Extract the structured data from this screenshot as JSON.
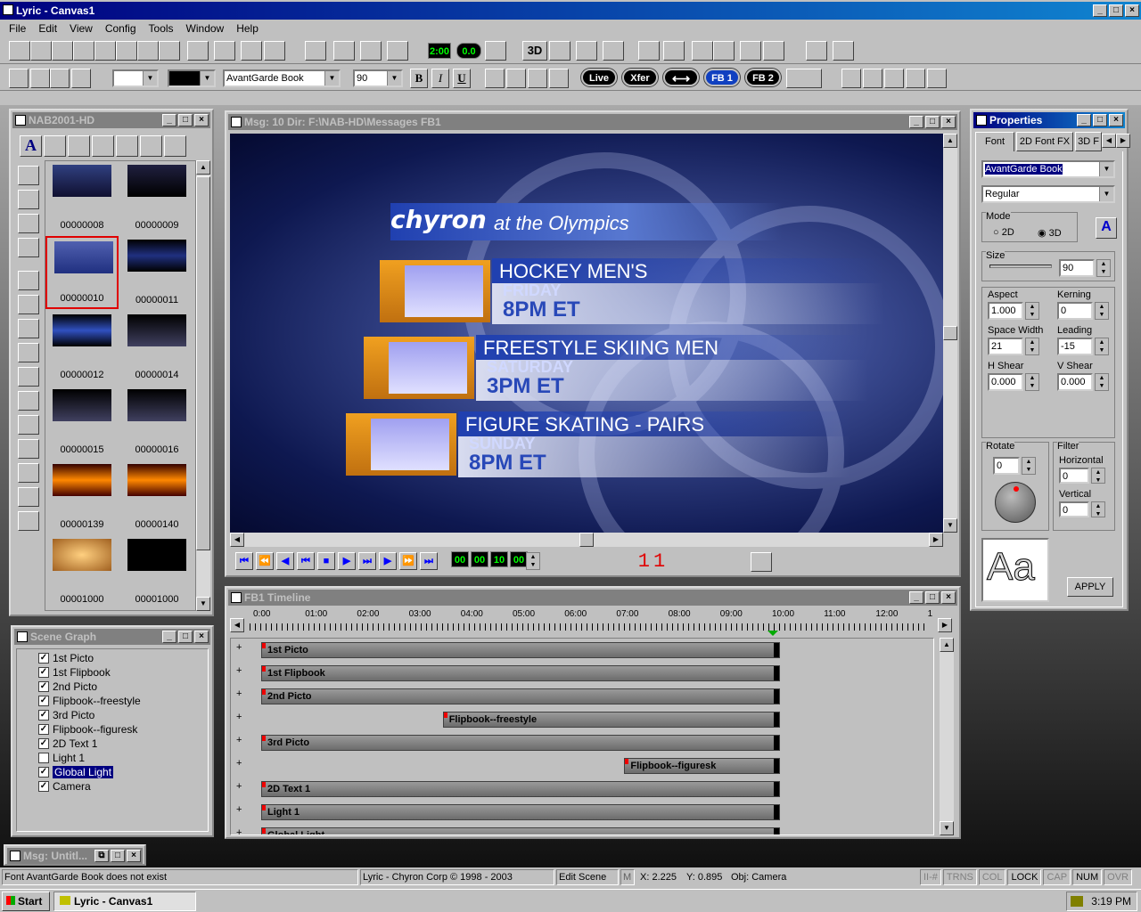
{
  "app": {
    "title": "Lyric - Canvas1"
  },
  "menu": [
    "File",
    "Edit",
    "View",
    "Config",
    "Tools",
    "Window",
    "Help"
  ],
  "toolbar2": {
    "font_name": "AvantGarde Book",
    "font_size": "90",
    "bold": "B",
    "italic": "I",
    "underline": "U",
    "pills": [
      "Live",
      "Xfer",
      "⟷",
      "FB 1",
      "FB 2"
    ]
  },
  "toolbar1": {
    "btn_3d": "3D",
    "btn_200": "2:00",
    "btn_00": "0.0"
  },
  "library": {
    "title": "NAB2001-HD",
    "thumbs": [
      "00000008",
      "00000009",
      "00000010",
      "00000011",
      "00000012",
      "00000014",
      "00000015",
      "00000016",
      "00000139",
      "00000140",
      "00001000",
      "00001000"
    ]
  },
  "scene_graph": {
    "title": "Scene Graph",
    "items": [
      {
        "label": "1st Picto",
        "checked": true
      },
      {
        "label": "1st Flipbook",
        "checked": true
      },
      {
        "label": "2nd Picto",
        "checked": true
      },
      {
        "label": "Flipbook--freestyle",
        "checked": true
      },
      {
        "label": "3rd Picto",
        "checked": true
      },
      {
        "label": "Flipbook--figuresk",
        "checked": true
      },
      {
        "label": "2D Text 1",
        "checked": true
      },
      {
        "label": "Light 1",
        "checked": false
      },
      {
        "label": "Global Light",
        "checked": true
      },
      {
        "label": "Camera",
        "checked": true
      }
    ]
  },
  "message": {
    "title": "Msg: 10   Dir: F:\\NAB-HD\\Messages   FB1",
    "brand": "chyron",
    "tagline": "at the Olympics",
    "events": [
      {
        "name": "HOCKEY MEN'S",
        "day": "FRIDAY",
        "time": "8PM ET"
      },
      {
        "name": "FREESTYLE SKIING MEN",
        "day": "SATURDAY",
        "time": "3PM ET"
      },
      {
        "name": "FIGURE SKATING - PAIRS",
        "day": "SUNDAY",
        "time": "8PM ET"
      }
    ],
    "counter": [
      "00",
      "00",
      "10",
      "00"
    ],
    "frame": "11"
  },
  "timeline": {
    "title": "FB1 Timeline",
    "ticks": [
      "0:00",
      "01:00",
      "02:00",
      "03:00",
      "04:00",
      "05:00",
      "06:00",
      "07:00",
      "08:00",
      "09:00",
      "10:00",
      "11:00",
      "12:00",
      "1"
    ],
    "tracks": [
      {
        "label": "1st Picto",
        "start": 0,
        "end": 10
      },
      {
        "label": "1st Flipbook",
        "start": 0,
        "end": 10
      },
      {
        "label": "2nd Picto",
        "start": 0,
        "end": 10
      },
      {
        "label": "Flipbook--freestyle",
        "start": 3.5,
        "end": 10
      },
      {
        "label": "3rd Picto",
        "start": 0,
        "end": 10
      },
      {
        "label": "Flipbook--figuresk",
        "start": 7,
        "end": 10
      },
      {
        "label": "2D Text 1",
        "start": 0,
        "end": 10
      },
      {
        "label": "Light 1",
        "start": 0,
        "end": 10
      },
      {
        "label": "Global Light",
        "start": 0,
        "end": 10
      }
    ]
  },
  "properties": {
    "title": "Properties",
    "tabs": [
      "Font",
      "2D Font FX",
      "3D F"
    ],
    "font": "AvantGarde Book",
    "style": "Regular",
    "mode_label": "Mode",
    "mode_2d": "2D",
    "mode_3d": "3D",
    "size_label": "Size",
    "size": "90",
    "aspect_label": "Aspect",
    "aspect": "1.000",
    "kerning_label": "Kerning",
    "kerning": "0",
    "spacewidth_label": "Space Width",
    "spacewidth": "21",
    "leading_label": "Leading",
    "leading": "-15",
    "hshear_label": "H Shear",
    "hshear": "0.000",
    "vshear_label": "V Shear",
    "vshear": "0.000",
    "rotate_label": "Rotate",
    "rotate": "0",
    "filter_label": "Filter",
    "horizontal_label": "Horizontal",
    "horizontal": "0",
    "vertical_label": "Vertical",
    "vertical": "0",
    "preview": "Aa",
    "apply": "APPLY"
  },
  "minimized": {
    "title": "Msg: Untitl..."
  },
  "status": {
    "message": "Font AvantGarde Book does not exist",
    "copyright": "Lyric - Chyron Corp © 1998 - 2003",
    "mode": "Edit Scene",
    "m": "M",
    "x": "X: 2.225",
    "y": "Y: 0.895",
    "obj": "Obj: Camera",
    "indicators": [
      "II-#",
      "TRNS",
      "COL",
      "LOCK",
      "CAP",
      "NUM",
      "OVR"
    ]
  },
  "taskbar": {
    "start": "Start",
    "task": "Lyric - Canvas1",
    "clock": "3:19 PM"
  }
}
